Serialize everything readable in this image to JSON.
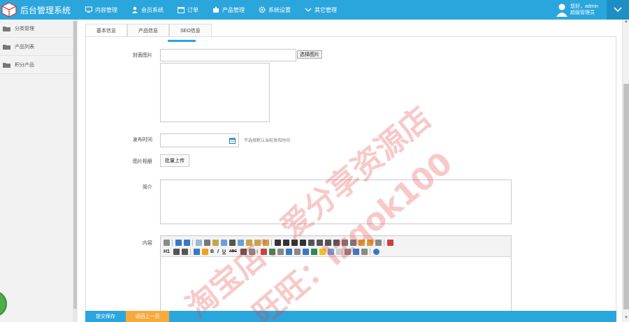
{
  "app": {
    "title": "后台管理系统"
  },
  "nav": [
    {
      "label": "内容管理",
      "icon": "monitor-icon"
    },
    {
      "label": "会员系统",
      "icon": "user-icon"
    },
    {
      "label": "订单",
      "icon": "calendar-icon"
    },
    {
      "label": "产品管理",
      "icon": "puzzle-icon"
    },
    {
      "label": "系统设置",
      "icon": "gear-icon"
    },
    {
      "label": "其它管理",
      "icon": "chevron-down-icon"
    }
  ],
  "user": {
    "greeting": "您好，admin",
    "role": "超级管理员"
  },
  "sidebar": {
    "items": [
      {
        "label": "分类管理"
      },
      {
        "label": "产品列表"
      },
      {
        "label": "积分产品"
      }
    ]
  },
  "tabs": [
    {
      "label": "基本信息"
    },
    {
      "label": "产品信息"
    },
    {
      "label": "SEO信息"
    }
  ],
  "form": {
    "cover_label": "封面图片",
    "choose_image": "选择图片",
    "publish_label": "发布时间",
    "publish_hint": "不选择默认当前发布时间",
    "album_label": "图片相册",
    "batch_upload": "批量上传",
    "intro_label": "简介",
    "content_label": "内容"
  },
  "editor": {
    "heading": "H1",
    "bold": "B",
    "italic": "I",
    "underline": "U",
    "strike": "ABC"
  },
  "bottom": {
    "submit": "提交保存",
    "back": "返回上一页"
  },
  "watermark": {
    "line1": "淘宝店：爱分享资源店",
    "line2": "旺旺：lzqok100"
  },
  "colors": {
    "primary": "#2ba6dc",
    "accent": "#f7a93b"
  }
}
